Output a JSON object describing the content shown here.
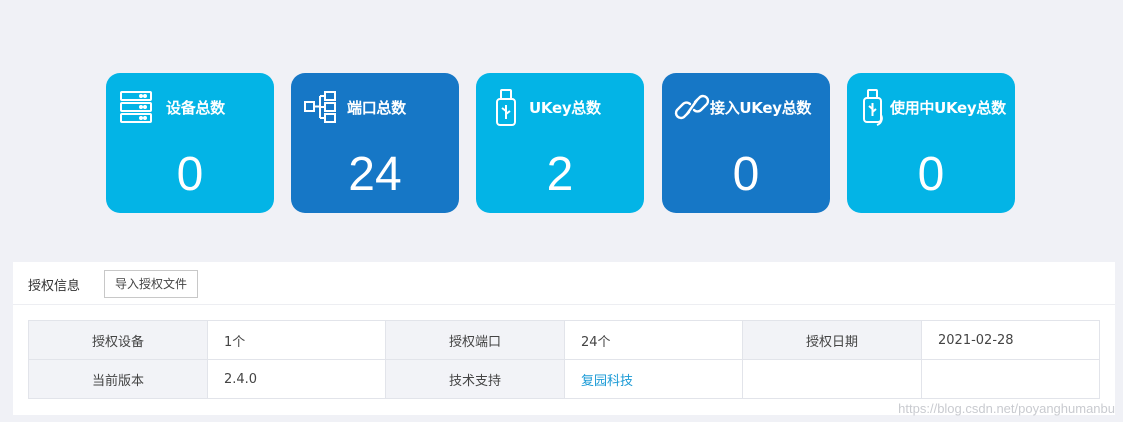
{
  "stats": [
    {
      "label": "设备总数",
      "value": "0",
      "icon": "server-icon",
      "color": "#03b4e6"
    },
    {
      "label": "端口总数",
      "value": "24",
      "icon": "network-ports-icon",
      "color": "#1677c6"
    },
    {
      "label": "UKey总数",
      "value": "2",
      "icon": "usb-key-icon",
      "color": "#03b4e6"
    },
    {
      "label": "接入UKey总数",
      "value": "0",
      "icon": "link-icon",
      "color": "#1677c6"
    },
    {
      "label": "使用中UKey总数",
      "value": "0",
      "icon": "usb-in-use-icon",
      "color": "#03b4e6"
    }
  ],
  "license": {
    "title": "授权信息",
    "import_button": "导入授权文件",
    "rows": [
      [
        {
          "key": "授权设备",
          "value": "1个"
        },
        {
          "key": "授权端口",
          "value": "24个"
        },
        {
          "key": "授权日期",
          "value": "2021-02-28"
        }
      ],
      [
        {
          "key": "当前版本",
          "value": "2.4.0"
        },
        {
          "key": "技术支持",
          "value": "复园科技"
        },
        {
          "key": "",
          "value": ""
        }
      ]
    ]
  },
  "watermark": "https://blog.csdn.net/poyanghumanbu"
}
